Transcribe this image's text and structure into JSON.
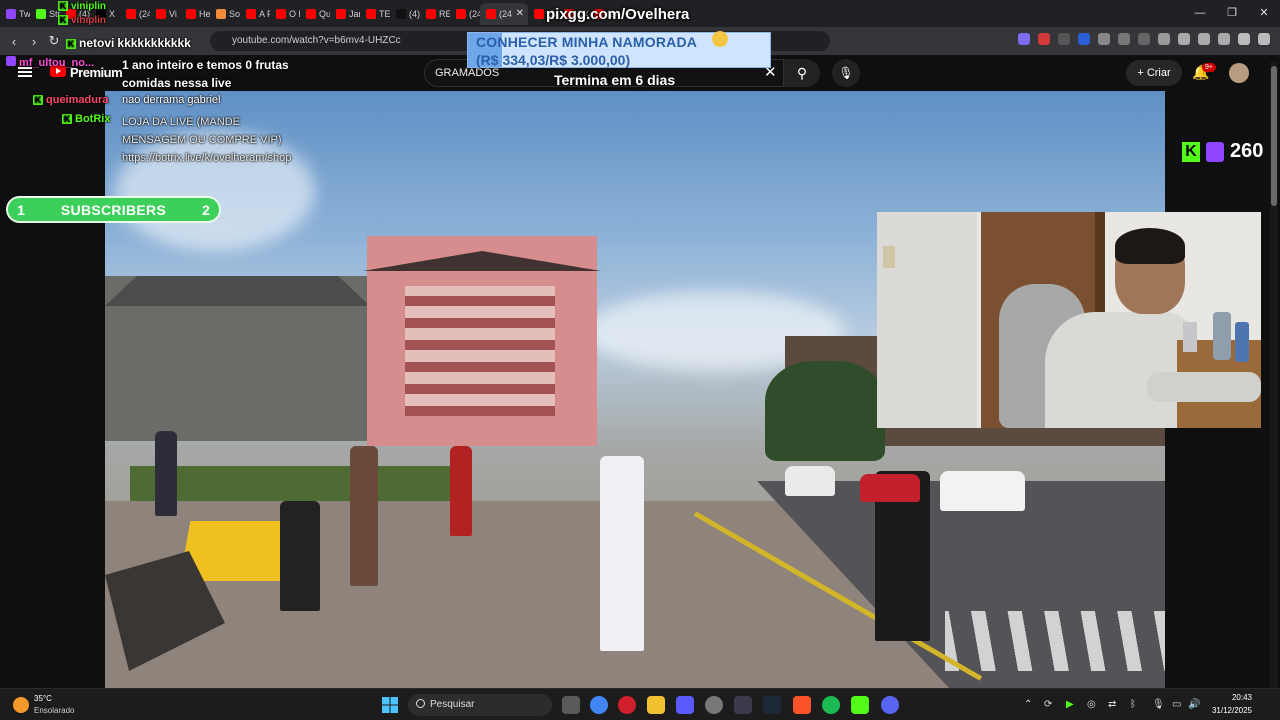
{
  "browser": {
    "tabs": [
      {
        "label": "Tw",
        "color": "#9146ff"
      },
      {
        "label": "Str",
        "color": "#53fc18"
      },
      {
        "label": "(4)",
        "color": "#ff0000"
      },
      {
        "label": "X",
        "color": "#000000"
      },
      {
        "label": "(24",
        "color": "#ff0000"
      },
      {
        "label": "Vi",
        "color": "#ff0000"
      },
      {
        "label": "He",
        "color": "#ff0000"
      },
      {
        "label": "So",
        "color": "#f28a3c"
      },
      {
        "label": "A F",
        "color": "#ff0000"
      },
      {
        "label": "O F",
        "color": "#ff0000"
      },
      {
        "label": "Qu",
        "color": "#ff0000"
      },
      {
        "label": "Jan",
        "color": "#ff0000"
      },
      {
        "label": "TE",
        "color": "#ff0000"
      },
      {
        "label": "(4)",
        "color": "#111111"
      },
      {
        "label": "RE",
        "color": "#ff0000"
      },
      {
        "label": "(24",
        "color": "#ff0000"
      },
      {
        "label": "(24",
        "color": "#ff0000"
      },
      {
        "label": "(24",
        "color": "#ff0000"
      },
      {
        "label": "(24",
        "color": "#ff0000"
      },
      {
        "label": "(24",
        "color": "#ff0000"
      }
    ],
    "url": "youtube.com/watch?v=b6mv4-UHZCc"
  },
  "youtube": {
    "brand": "Premium",
    "search_value": "GRAMADOS",
    "create_label": "Criar",
    "notif_badge": "9+"
  },
  "overlay": {
    "pix_url": "pixgg.com/Ovelhera",
    "goal_title": "CONHECER MINHA NAMORADA",
    "goal_amount": "(R$ 334,03/R$ 3.000,00)",
    "goal_progress": 0.111,
    "goal_ends": "Termina em 6 dias",
    "subs_current": "1",
    "subs_label": "SUBSCRIBERS",
    "subs_goal": "2",
    "viewer_count": "260"
  },
  "chat": [
    {
      "user": "viniplin",
      "user_color": "#53fc18",
      "msg": ""
    },
    {
      "user": "viniplin",
      "user_color": "#d43f3f",
      "msg": ""
    },
    {
      "user": "netovi",
      "user_color": "#ffffff",
      "msg": "kkkkkkkkkkk"
    },
    {
      "user": "mf_ultou_no...",
      "user_color": "#ff4fd8",
      "msg": "1 ano inteiro e temos 0 frutas comidas nessa live"
    },
    {
      "user": "queimadura",
      "user_color": "#ff4a6a",
      "msg": "nao derrama gabriel"
    },
    {
      "user": "BotRix",
      "user_color": "#53fc18",
      "msg": "LOJA DA LIVE (MANDE MENSAGEM OU COMPRE VIP) https://botrix.live/k/ovelheram/shop"
    }
  ],
  "taskbar": {
    "weather_temp": "35°C",
    "weather_desc": "Ensolarado",
    "search_placeholder": "Pesquisar",
    "time": "20:43",
    "date": "31/12/2025"
  }
}
